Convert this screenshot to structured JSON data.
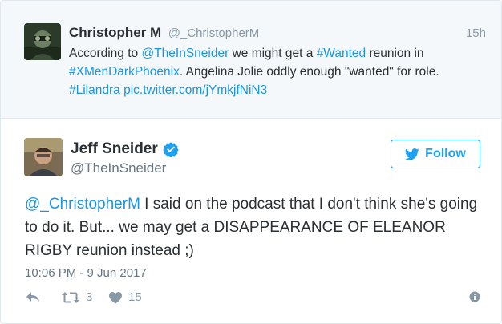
{
  "parent_tweet": {
    "author_name": "Christopher M",
    "author_handle": "@_ChristopherM",
    "timestamp": "15h",
    "text_parts": [
      {
        "t": "According to ",
        "link": false
      },
      {
        "t": "@TheInSneider",
        "link": true
      },
      {
        "t": " we might get a ",
        "link": false
      },
      {
        "t": "#Wanted",
        "link": true
      },
      {
        "t": " reunion in ",
        "link": false
      },
      {
        "t": "#XMenDarkPhoenix",
        "link": true
      },
      {
        "t": ". Angelina Jolie oddly enough \"wanted\" for role. ",
        "link": false
      },
      {
        "t": "#Lilandra",
        "link": true
      },
      {
        "t": " ",
        "link": false
      },
      {
        "t": "pic.twitter.com/jYmkjfNiN3",
        "link": true
      }
    ]
  },
  "main_tweet": {
    "author_name": "Jeff Sneider",
    "author_handle": "@TheInSneider",
    "verified": true,
    "follow_label": "Follow",
    "reply_to": "@_ChristopherM",
    "text": " I said on the podcast that I don't think she's going to do it. But... we may get a DISAPPEARANCE OF ELEANOR RIGBY reunion instead ;)",
    "date": "10:06 PM - 9 Jun 2017",
    "retweet_count": "3",
    "like_count": "15"
  },
  "icons": {
    "reply": "reply-icon",
    "retweet": "retweet-icon",
    "like": "heart-icon",
    "info": "info-icon",
    "verified": "verified-badge-icon",
    "follow_bird": "twitter-bird-icon"
  },
  "colors": {
    "link": "#1b95e0",
    "follow": "#1da1f2",
    "muted": "#8899a6",
    "parent_bg": "#f5f8fa"
  }
}
